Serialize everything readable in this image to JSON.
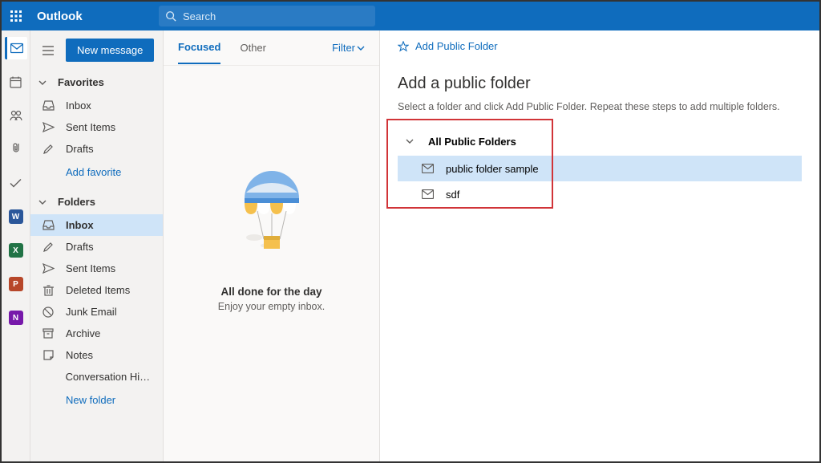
{
  "header": {
    "brand": "Outlook",
    "search_placeholder": "Search"
  },
  "rail_items": [
    {
      "name": "mail",
      "color": "#0F6CBD",
      "active": true
    },
    {
      "name": "calendar",
      "color": "#605e5c"
    },
    {
      "name": "people",
      "color": "#605e5c"
    },
    {
      "name": "files",
      "color": "#605e5c"
    },
    {
      "name": "todo",
      "color": "#605e5c"
    },
    {
      "name": "word",
      "color": "#2B579A"
    },
    {
      "name": "excel",
      "color": "#217346"
    },
    {
      "name": "powerpoint",
      "color": "#B7472A"
    },
    {
      "name": "onenote",
      "color": "#7719AA"
    }
  ],
  "new_message_label": "New message",
  "sections": {
    "favorites_label": "Favorites",
    "folders_label": "Folders"
  },
  "favorites": [
    {
      "label": "Inbox",
      "icon": "inbox",
      "selected": false
    },
    {
      "label": "Sent Items",
      "icon": "send",
      "selected": false
    },
    {
      "label": "Drafts",
      "icon": "draft",
      "selected": false
    }
  ],
  "add_favorite_label": "Add favorite",
  "folders": [
    {
      "label": "Inbox",
      "icon": "inbox",
      "selected": true
    },
    {
      "label": "Drafts",
      "icon": "draft",
      "selected": false
    },
    {
      "label": "Sent Items",
      "icon": "send",
      "selected": false
    },
    {
      "label": "Deleted Items",
      "icon": "trash",
      "selected": false
    },
    {
      "label": "Junk Email",
      "icon": "junk",
      "selected": false
    },
    {
      "label": "Archive",
      "icon": "archive",
      "selected": false
    },
    {
      "label": "Notes",
      "icon": "note",
      "selected": false
    },
    {
      "label": "Conversation Hist...",
      "icon": "none",
      "selected": false
    }
  ],
  "new_folder_label": "New folder",
  "tabs": {
    "focused": "Focused",
    "other": "Other",
    "filter": "Filter"
  },
  "empty_state": {
    "title": "All done for the day",
    "subtitle": "Enjoy your empty inbox."
  },
  "panel": {
    "add_link": "Add Public Folder",
    "title": "Add a public folder",
    "description": "Select a folder and click Add Public Folder. Repeat these steps to add multiple folders.",
    "root_label": "All Public Folders",
    "items": [
      {
        "label": "public folder sample",
        "selected": true
      },
      {
        "label": "sdf",
        "selected": false
      }
    ]
  }
}
